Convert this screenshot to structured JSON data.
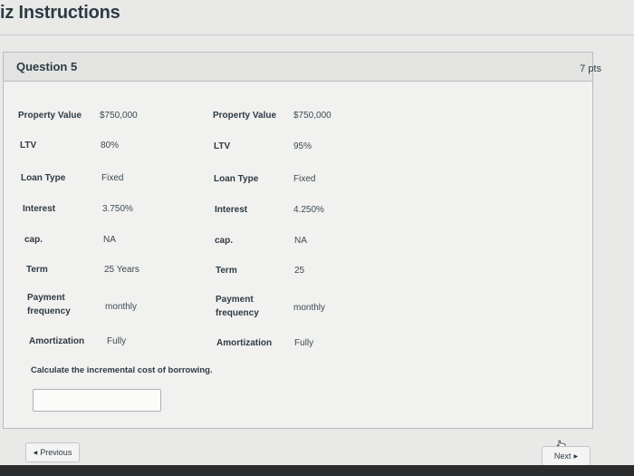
{
  "page": {
    "title": "iz Instructions"
  },
  "question": {
    "name": "Question 5",
    "points": "7 pts",
    "left_table": [
      {
        "label": "Property Value",
        "value": "$750,000"
      },
      {
        "label": "LTV",
        "value": "80%"
      },
      {
        "label": "Loan Type",
        "value": "Fixed"
      },
      {
        "label": "Interest",
        "value": "3.750%"
      },
      {
        "label": "cap.",
        "value": "NA"
      },
      {
        "label": "Term",
        "value": "25 Years"
      },
      {
        "label": "Payment frequency",
        "value": "monthly"
      },
      {
        "label": "Amortization",
        "value": "Fully"
      }
    ],
    "right_table": [
      {
        "label": "Property Value",
        "value": "$750,000"
      },
      {
        "label": "LTV",
        "value": "95%"
      },
      {
        "label": "Loan Type",
        "value": "Fixed"
      },
      {
        "label": "Interest",
        "value": "4.250%"
      },
      {
        "label": "cap.",
        "value": "NA"
      },
      {
        "label": "Term",
        "value": "25"
      },
      {
        "label": "Payment frequency",
        "value": "monthly"
      },
      {
        "label": "Amortization",
        "value": "Fully"
      }
    ],
    "prompt": "Calculate the incremental cost of borrowing.",
    "answer_value": ""
  },
  "nav": {
    "previous_label": "Previous",
    "next_label": "Next"
  }
}
